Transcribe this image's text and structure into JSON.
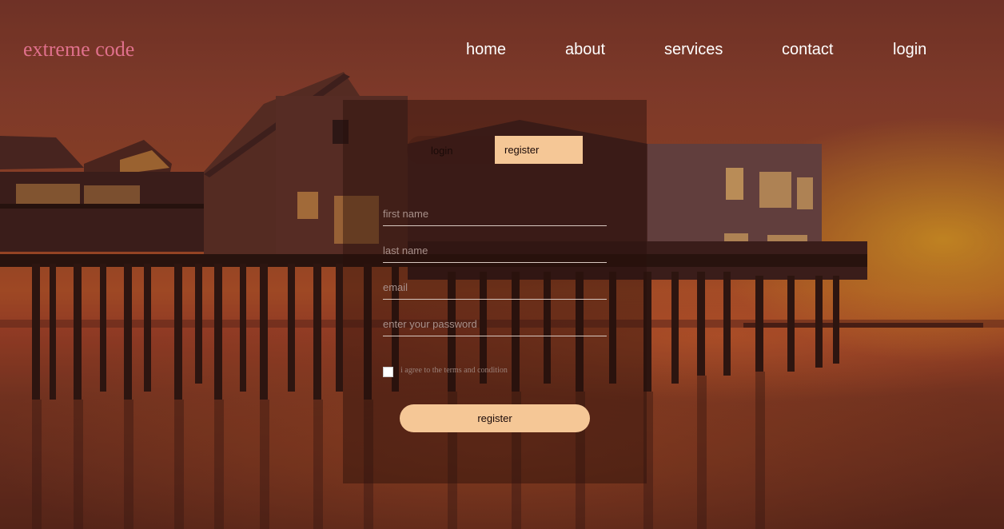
{
  "brand": {
    "logo_text": "extreme code"
  },
  "nav": {
    "items": [
      {
        "label": "home"
      },
      {
        "label": "about"
      },
      {
        "label": "services"
      },
      {
        "label": "contact"
      },
      {
        "label": "login"
      }
    ]
  },
  "form": {
    "toggle": {
      "login_label": "login",
      "register_label": "register"
    },
    "fields": {
      "first_name_placeholder": "first name",
      "last_name_placeholder": "last name",
      "email_placeholder": "email",
      "password_placeholder": "enter your password"
    },
    "terms_label": "i agree to the terms and condition",
    "submit_label": "register"
  },
  "colors": {
    "accent": "#f5c796",
    "logo": "#e0708c"
  }
}
